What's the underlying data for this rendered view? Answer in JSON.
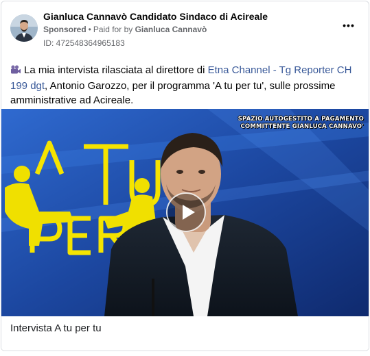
{
  "post": {
    "page_name": "Gianluca Cannavò Candidato Sindaco di Acireale",
    "sponsored": "Sponsored",
    "separator": "•",
    "paid_for_by": "Paid for by",
    "advertiser": "Gianluca Cannavò",
    "ad_id": "ID: 472548364965183",
    "more_icon": "ellipsis-icon",
    "more_label": "•••"
  },
  "body": {
    "icon": "video-camera-icon",
    "text_before": "La mia intervista rilasciata al direttore di ",
    "link_text": "Etna Channel - Tg Reporter CH 199 dgt",
    "text_after": ", Antonio Garozzo, per il programma 'A tu per tu', sulle prossime amministrative ad Acireale."
  },
  "media": {
    "overlay_line1": "SPAZIO AUTOGESTITO A PAGAMENTO",
    "overlay_line2": "COMMITTENTE GIANLUCA CANNAVO'",
    "logo_text_line1": "^TU",
    "logo_text_line2": "PER",
    "play_icon": "play-icon"
  },
  "caption": {
    "title": "Intervista A tu per tu"
  },
  "colors": {
    "link": "#385898",
    "muted": "#65676b",
    "video_bg": "#1f4fa8",
    "logo_yellow": "#f5e400"
  }
}
